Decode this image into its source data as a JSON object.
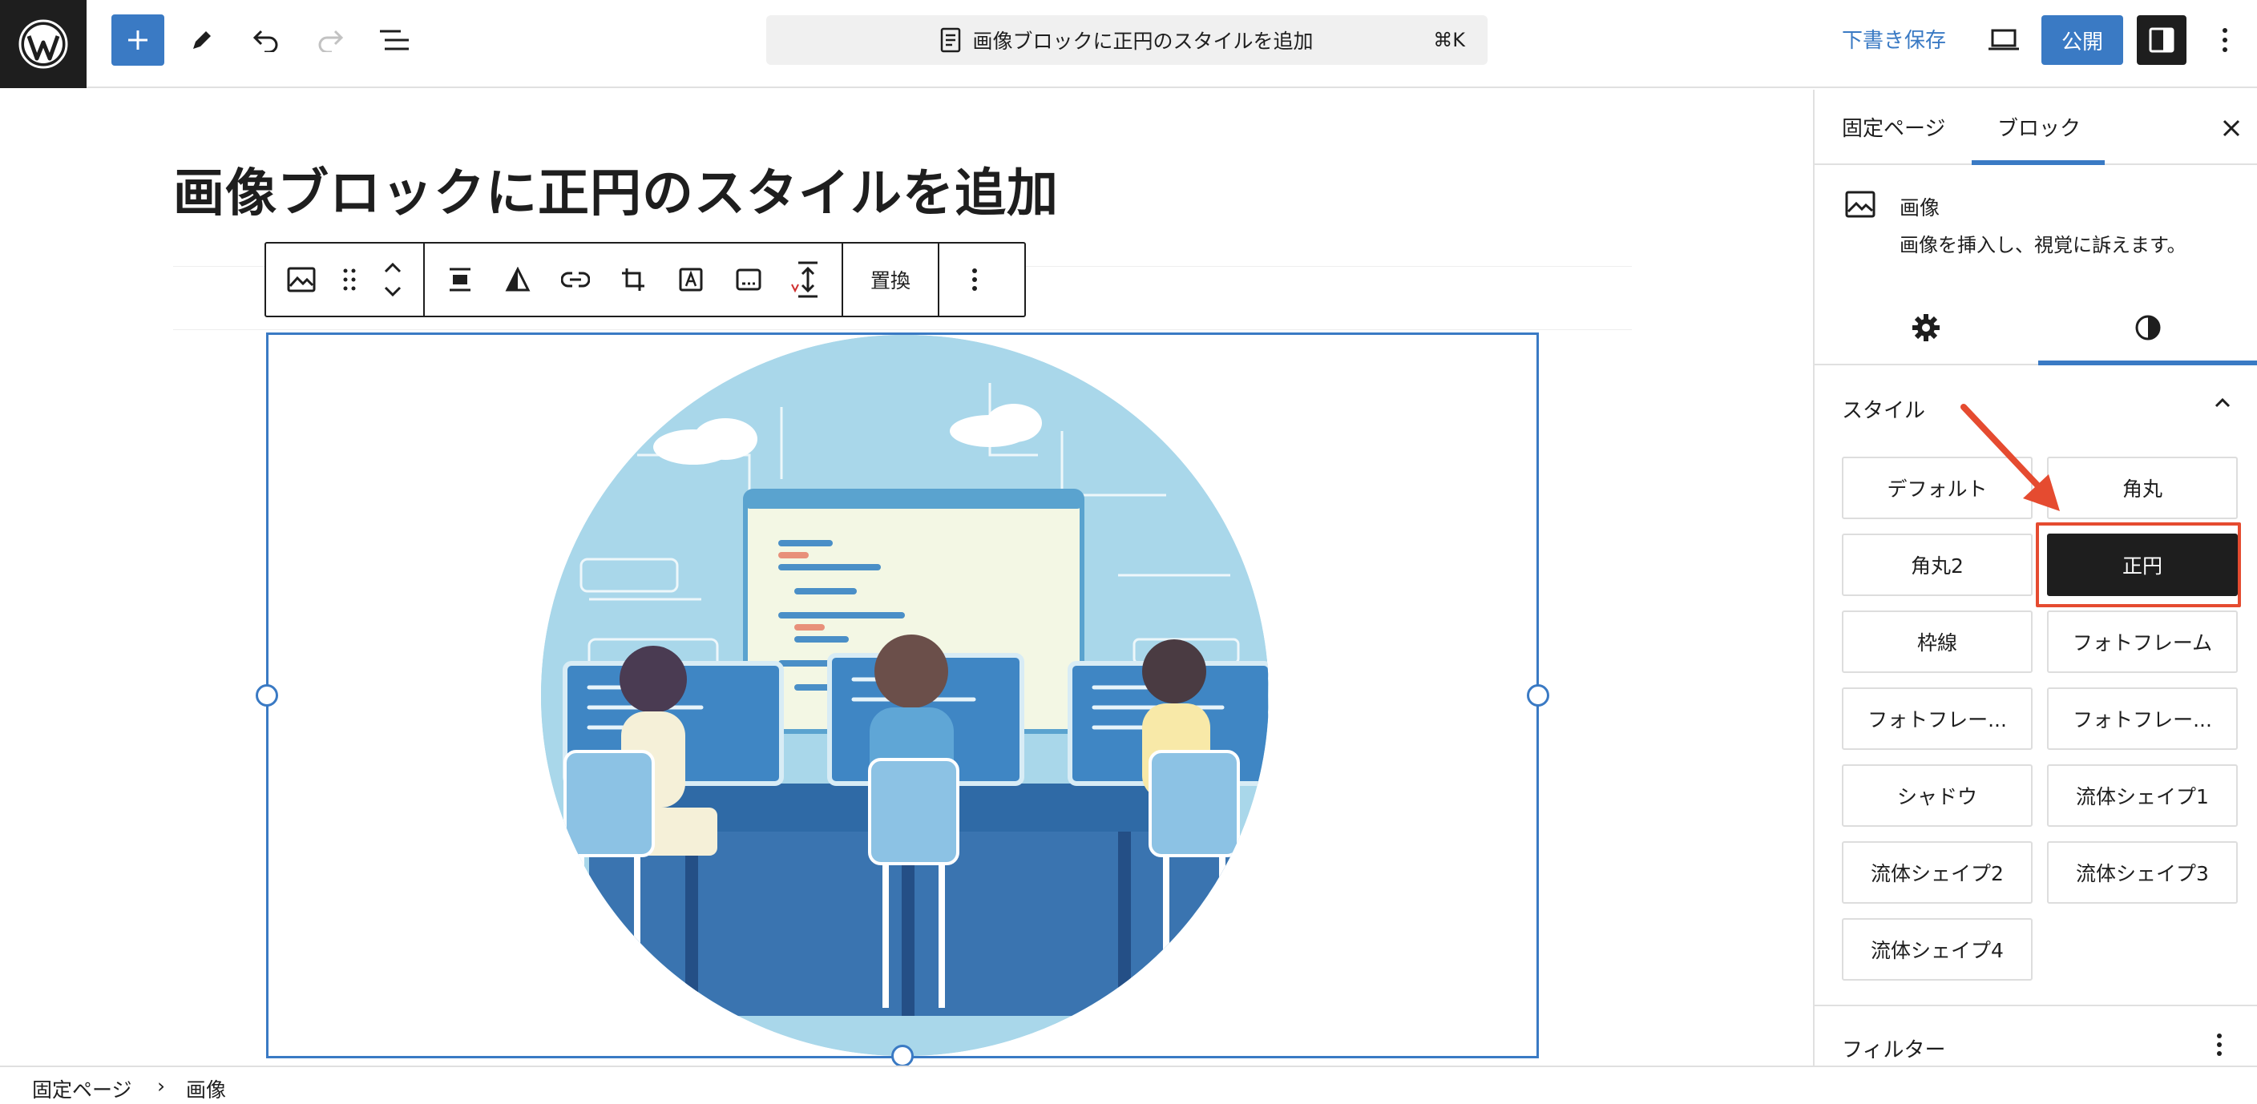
{
  "header": {
    "command_bar_text": "画像ブロックに正円のスタイルを追加",
    "command_shortcut": "⌘K",
    "save_draft_label": "下書き保存",
    "publish_label": "公開"
  },
  "editor": {
    "page_title": "画像ブロックに正円のスタイルを追加",
    "toolbar": {
      "replace_label": "置換"
    }
  },
  "sidebar": {
    "tabs": [
      {
        "label": "固定ページ",
        "active": false
      },
      {
        "label": "ブロック",
        "active": true
      }
    ],
    "block": {
      "name": "画像",
      "description": "画像を挿入し、視覚に訴えます。"
    },
    "styles_title": "スタイル",
    "styles": [
      {
        "label": "デフォルト",
        "active": false
      },
      {
        "label": "角丸",
        "active": false
      },
      {
        "label": "角丸2",
        "active": false
      },
      {
        "label": "正円",
        "active": true
      },
      {
        "label": "枠線",
        "active": false
      },
      {
        "label": "フォトフレーム",
        "active": false
      },
      {
        "label": "フォトフレー...",
        "active": false
      },
      {
        "label": "フォトフレー...",
        "active": false
      },
      {
        "label": "シャドウ",
        "active": false
      },
      {
        "label": "流体シェイプ1",
        "active": false
      },
      {
        "label": "流体シェイプ2",
        "active": false
      },
      {
        "label": "流体シェイプ3",
        "active": false
      },
      {
        "label": "流体シェイプ4",
        "active": false
      }
    ],
    "filter_title": "フィルター"
  },
  "breadcrumb": {
    "items": [
      "固定ページ",
      "画像"
    ],
    "separator": "›"
  },
  "colors": {
    "accent": "#3a7ac4",
    "dark": "#1e1e1e",
    "annotation": "#e54b30"
  }
}
